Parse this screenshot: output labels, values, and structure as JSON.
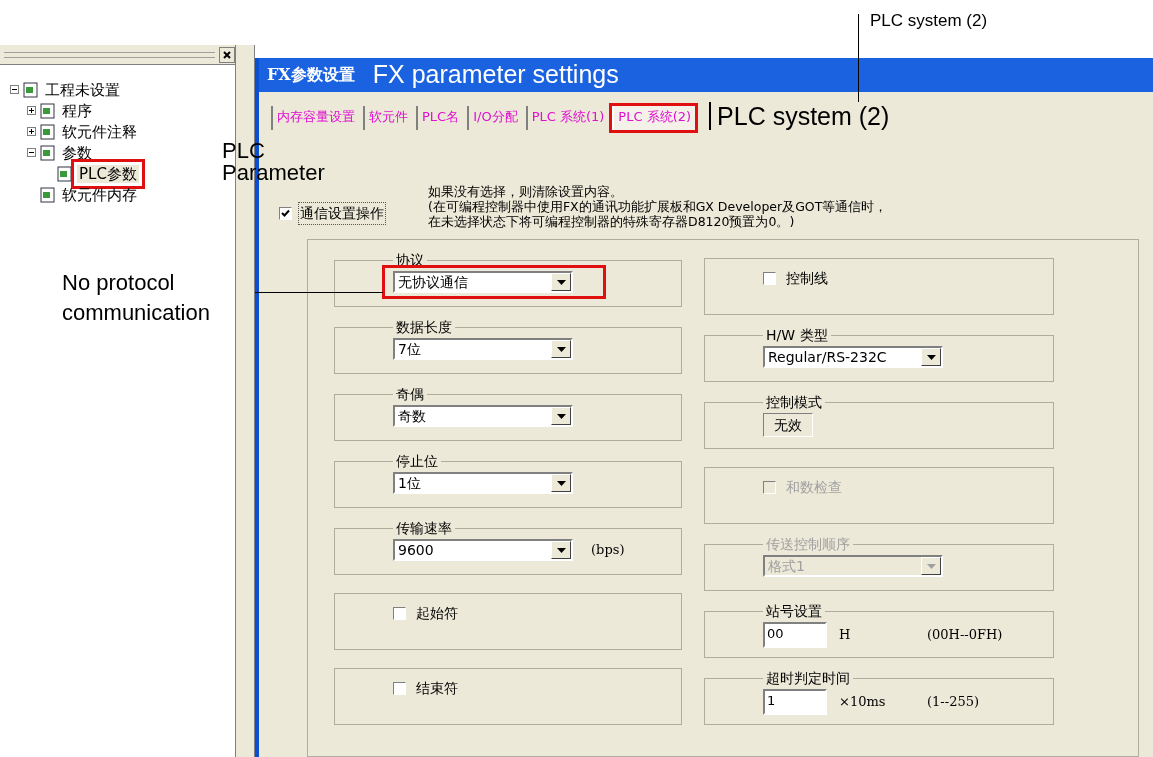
{
  "annotations": {
    "tab_callout": "PLC system (2)",
    "tab_label": "PLC system (2)",
    "tree_label": "PLC Parameter",
    "protocol_label": "No protocol communication"
  },
  "tree": {
    "label": "工程未设置",
    "expanded": true,
    "highlighted": false,
    "children": [
      {
        "label": "程序",
        "expanded": false,
        "highlighted": false
      },
      {
        "label": "软元件注释",
        "expanded": false,
        "highlighted": false
      },
      {
        "label": "参数",
        "expanded": true,
        "highlighted": false,
        "children": [
          {
            "label": "PLC参数",
            "highlighted": true
          }
        ]
      },
      {
        "label": "软元件内存",
        "highlighted": false
      }
    ]
  },
  "dialog": {
    "title": "FX参数设置",
    "title_translation": "FX parameter settings",
    "tabs": [
      {
        "label": "内存容量设置",
        "selected": false,
        "highlighted": false
      },
      {
        "label": "软元件",
        "selected": false,
        "highlighted": false
      },
      {
        "label": "PLC名",
        "selected": false,
        "highlighted": false
      },
      {
        "label": "I/O分配",
        "selected": false,
        "highlighted": false
      },
      {
        "label": "PLC 系统(1)",
        "selected": false,
        "highlighted": false
      },
      {
        "label": "PLC 系统(2)",
        "selected": true,
        "highlighted": true
      }
    ],
    "comm_setting": {
      "label": "通信设置操作",
      "checked": true
    },
    "note": [
      "如果没有选择，则清除设置内容。",
      "(在可编程控制器中使用FX的通讯功能扩展板和GX Developer及GOT等通信时，",
      "在未选择状态下将可编程控制器的特殊寄存器D8120预置为0。)"
    ],
    "left_groups": [
      {
        "kind": "select",
        "legend": "协议",
        "value": "无协议通信",
        "highlighted": true,
        "disabled": false
      },
      {
        "kind": "select",
        "legend": "数据长度",
        "value": "7位",
        "highlighted": false,
        "disabled": false
      },
      {
        "kind": "select",
        "legend": "奇偶",
        "value": "奇数",
        "highlighted": false,
        "disabled": false
      },
      {
        "kind": "select",
        "legend": "停止位",
        "value": "1位",
        "highlighted": false,
        "disabled": false
      },
      {
        "kind": "select",
        "legend": "传输速率",
        "value": "9600",
        "suffix": "(bps)",
        "highlighted": false,
        "disabled": false
      },
      {
        "kind": "checkbox",
        "label": "起始符",
        "checked": false,
        "disabled": false
      },
      {
        "kind": "checkbox",
        "label": "结束符",
        "checked": false,
        "disabled": false
      }
    ],
    "right_groups": [
      {
        "kind": "checkbox",
        "label": "控制线",
        "checked": false,
        "disabled": false
      },
      {
        "kind": "select",
        "legend": "H/W 类型",
        "value": "Regular/RS-232C",
        "highlighted": false,
        "disabled": false
      },
      {
        "kind": "readonly",
        "legend": "控制模式",
        "value": "无效"
      },
      {
        "kind": "checkbox",
        "label": "和数检查",
        "checked": false,
        "disabled": true
      },
      {
        "kind": "select",
        "legend": "传送控制顺序",
        "value": "格式1",
        "highlighted": false,
        "disabled": true
      },
      {
        "kind": "input",
        "legend": "站号设置",
        "value": "00",
        "unit": "H",
        "range": "(00H--0FH)"
      },
      {
        "kind": "input",
        "legend": "超时判定时间",
        "value": "1",
        "unit": "×10ms",
        "range": "(1--255)"
      }
    ]
  }
}
